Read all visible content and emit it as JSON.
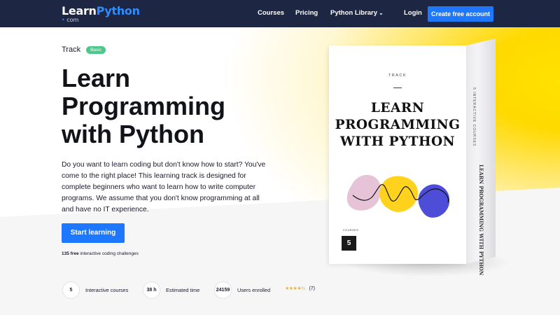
{
  "nav": {
    "logo_part1": "Learn",
    "logo_part2": "Python",
    "logo_sub_dot": "•",
    "logo_sub": "com",
    "links": {
      "courses": "Courses",
      "pricing": "Pricing",
      "library": "Python Library"
    },
    "login": "Login",
    "cta": "Create free account"
  },
  "hero": {
    "track_label": "Track",
    "badge": "Basic",
    "title_lines": [
      "Learn",
      "Programming",
      "with Python"
    ],
    "description": "Do you want to learn coding but don't know how to start? You've come to the right place! This learning track is designed for complete beginners who want to learn how to write computer programs. We assume that you don't know programming at all and have no IT experience.",
    "start_button": "Start learning",
    "challenges_bold": "135 free",
    "challenges_rest": " interactive coding challenges"
  },
  "stats": [
    {
      "value": "5",
      "label": "Interactive courses"
    },
    {
      "value": "38 h",
      "label": "Estimated time"
    },
    {
      "value": "24159",
      "label": "Users enrolled"
    }
  ],
  "rating": {
    "stars": "★★★★½",
    "count": "(7)",
    "value": 4.5
  },
  "box": {
    "track": "TRACK",
    "title_lines": [
      "LEARN",
      "PROGRAMMING",
      "WITH PYTHON"
    ],
    "side_top": "5 INTERACTIVE COURSES",
    "side_bottom": "LEARN PROGRAMMING WITH PYTHON",
    "courses_label": "COURSES",
    "courses_count": "5"
  },
  "colors": {
    "nav_bg": "#1d2744",
    "accent_blue": "#1e77ff",
    "badge_green": "#4cc88a",
    "blob_pink": "#e6c3d6",
    "blob_yellow": "#ffd21e",
    "blob_purple": "#4d4dd8"
  }
}
